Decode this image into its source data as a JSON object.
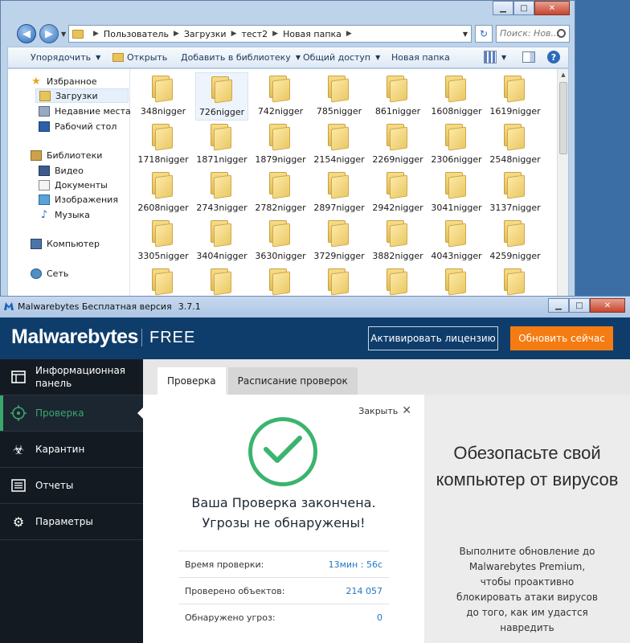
{
  "explorer": {
    "breadcrumbs": [
      "Пользователь",
      "Загрузки",
      "тест2",
      "Новая папка"
    ],
    "search_placeholder": "Поиск: Нов...",
    "toolbar": {
      "organize": "Упорядочить",
      "open": "Открыть",
      "add_to_library": "Добавить в библиотеку",
      "share": "Общий доступ",
      "new_folder": "Новая папка"
    },
    "nav": {
      "favorites": "Избранное",
      "downloads": "Загрузки",
      "recent": "Недавние места",
      "desktop": "Рабочий стол",
      "libraries": "Библиотеки",
      "video": "Видео",
      "documents": "Документы",
      "images": "Изображения",
      "music": "Музыка",
      "computer": "Компьютер",
      "network": "Сеть"
    },
    "folders": [
      "348nigger",
      "726nigger",
      "742nigger",
      "785nigger",
      "861nigger",
      "1608nigger",
      "1619nigger",
      "1718nigger",
      "1871nigger",
      "1879nigger",
      "2154nigger",
      "2269nigger",
      "2306nigger",
      "2548nigger",
      "2608nigger",
      "2743nigger",
      "2782nigger",
      "2897nigger",
      "2942nigger",
      "3041nigger",
      "3137nigger",
      "3305nigger",
      "3404nigger",
      "3630nigger",
      "3729nigger",
      "3882nigger",
      "4043nigger",
      "4259nigger",
      "",
      "",
      "",
      "",
      "",
      "",
      ""
    ]
  },
  "malwarebytes": {
    "window_title": "Malwarebytes Бесплатная версия",
    "version": "3.7.1",
    "brand": "Malwarebytes",
    "edition": "FREE",
    "activate_label": "Активировать лицензию",
    "upgrade_label": "Обновить сейчас",
    "sidebar": {
      "dashboard": "Информационная панель",
      "scan": "Проверка",
      "quarantine": "Карантин",
      "reports": "Отчеты",
      "settings": "Параметры"
    },
    "tabs": {
      "scan": "Проверка",
      "schedule": "Расписание проверок"
    },
    "close_label": "Закрыть",
    "result_line1": "Ваша Проверка закончена.",
    "result_line2": "Угрозы не обнаружены!",
    "stats": {
      "time_label": "Время проверки:",
      "time_value": "13мин : 56с",
      "objects_label": "Проверено объектов:",
      "objects_value": "214 057",
      "threats_label": "Обнаружено угроз:",
      "threats_value": "0"
    },
    "promo_title": "Обезопасьте свой компьютер от вирусов",
    "promo_text": "Выполните обновление до Malwarebytes Premium, чтобы проактивно блокировать атаки вирусов до того, как им удастся навредить",
    "accent_color": "#3bb46e",
    "upgrade_color": "#f57c12"
  }
}
